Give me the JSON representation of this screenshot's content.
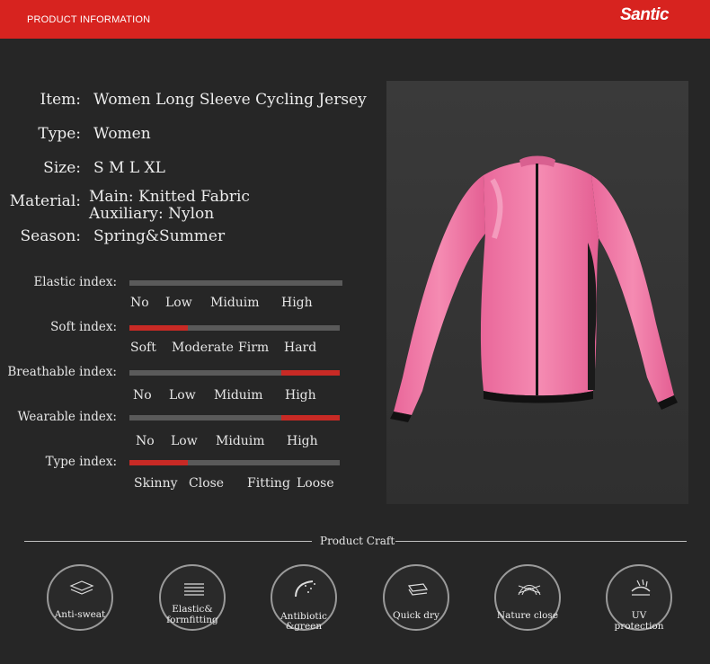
{
  "header": {
    "title": "PRODUCT INFORMATION",
    "brand": "Santic"
  },
  "specs": [
    {
      "label": "Item:",
      "value": "Women Long Sleeve Cycling Jersey"
    },
    {
      "label": "Type:",
      "value": "Women"
    },
    {
      "label": "Size:",
      "value": "S M L XL"
    },
    {
      "label": "Material:",
      "value": "Main: Knitted Fabric",
      "value2": "Auxiliary: Nylon"
    },
    {
      "label": "Season:",
      "value": "Spring&Summer"
    }
  ],
  "indices": [
    {
      "label": "Elastic index:",
      "options": [
        "No",
        "Low",
        "Miduim",
        "High"
      ],
      "filled_segment": null
    },
    {
      "label": "Soft index:",
      "options": [
        "Soft",
        "Moderate",
        "Firm",
        "Hard"
      ],
      "filled_segment": 1
    },
    {
      "label": "Breathable index:",
      "options": [
        "No",
        "Low",
        "Miduim",
        "High"
      ],
      "filled_segment": 4
    },
    {
      "label": "Wearable index:",
      "options": [
        "No",
        "Low",
        "Miduim",
        "High"
      ],
      "filled_segment": 4
    },
    {
      "label": "Type index:",
      "options": [
        "Skinny",
        "Close",
        "Fitting",
        "Loose"
      ],
      "filled_segment": 1
    }
  ],
  "craft": {
    "title": "Product Craft",
    "items": [
      {
        "label": "Anti-sweat",
        "icon": "anti-sweat-icon"
      },
      {
        "label": "Elastic&",
        "label2": "formfitting",
        "icon": "elastic-icon"
      },
      {
        "label": "Antibiotic",
        "label2": "&green",
        "icon": "antibiotic-icon"
      },
      {
        "label": "Quick dry",
        "icon": "quick-dry-icon"
      },
      {
        "label": "Nature close",
        "icon": "nature-close-icon"
      },
      {
        "label": "UV protection",
        "icon": "uv-protection-icon"
      }
    ]
  },
  "colors": {
    "accent": "#d7231f",
    "jersey": "#f07aa4",
    "background": "#262626"
  }
}
